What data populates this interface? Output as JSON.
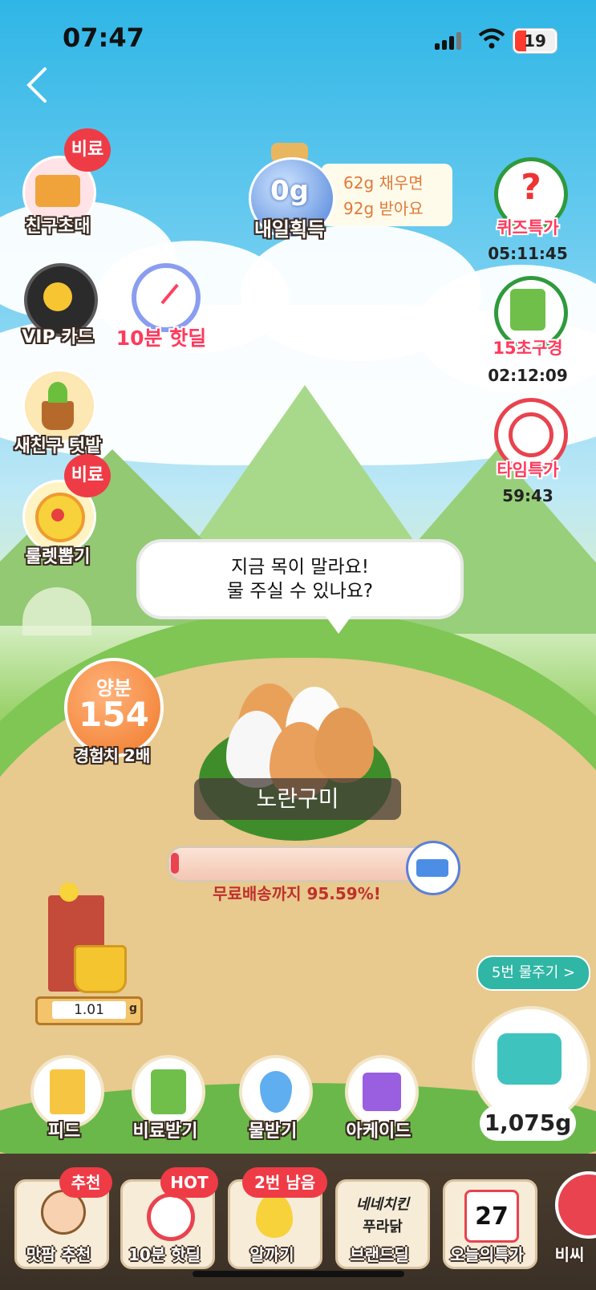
{
  "status_bar": {
    "time": "07:47",
    "battery": "19"
  },
  "left_menu": [
    {
      "label": "친구초대",
      "badge": "비료"
    },
    {
      "label": "VIP 카드"
    },
    {
      "label": "새친구 텃밭"
    },
    {
      "label": "룰렛뽑기",
      "badge": "비료"
    }
  ],
  "hot_deal_label": "10분 핫딜",
  "tomorrow": {
    "amount": "0g",
    "label": "내일획득",
    "tip_line1": "62g 채우면",
    "tip_line2": "92g 받아요"
  },
  "right_menu": [
    {
      "label": "퀴즈특가",
      "timer": "05:11:45"
    },
    {
      "label": "15초구경",
      "timer": "02:12:09"
    },
    {
      "label": "타임특가",
      "timer": "59:43"
    }
  ],
  "speech": {
    "line1": "지금 목이 말라요!",
    "line2": "물 주실 수 있나요?"
  },
  "nutrient": {
    "title": "양분",
    "value": "154",
    "sub": "경험치 2배"
  },
  "plant_name": "노란구미",
  "progress": {
    "text": "무료배송까지 95.59%!",
    "percent": 95.59
  },
  "water_tank": {
    "value": "1.01",
    "unit": "g"
  },
  "watering": {
    "button": "5번 물주기 >",
    "amount": "1,075g"
  },
  "actions": [
    "피드",
    "비료받기",
    "물받기",
    "아케이드"
  ],
  "dock": [
    {
      "label": "맛팜 추천",
      "badge": "추천"
    },
    {
      "label": "10분 핫딜",
      "badge": "HOT"
    },
    {
      "label": "알까기",
      "badge": "2번 남음"
    },
    {
      "label": "브랜드딜",
      "brand1": "네네치킨",
      "brand2": "푸라닭"
    },
    {
      "label": "오늘의특가",
      "date": "27"
    },
    {
      "label": "비씨"
    }
  ],
  "colors": {
    "accent_red": "#ef3b46",
    "teal": "#2fb6a4",
    "orange": "#f07a2a"
  }
}
